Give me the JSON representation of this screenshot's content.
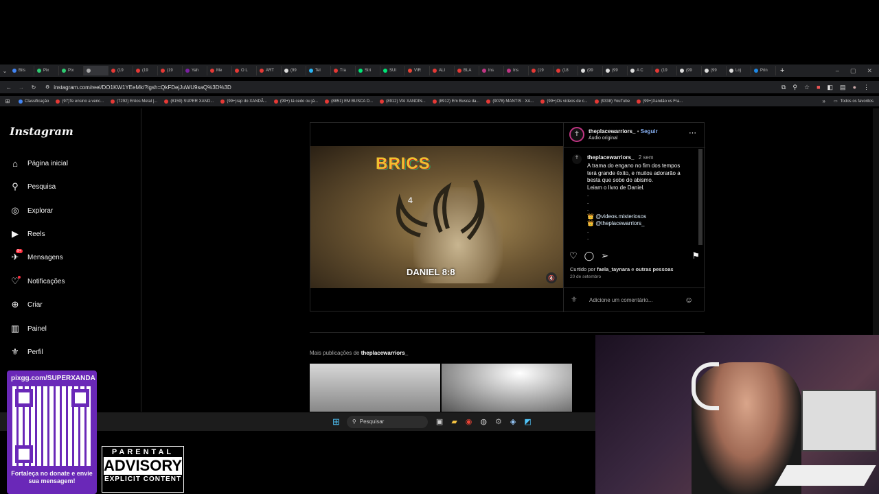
{
  "tabs": [
    "Bits",
    "Pix",
    "Pix",
    "",
    "(19",
    "(19",
    "(19",
    "Yah",
    "Me",
    "O L",
    "ART",
    "(99",
    "Tel",
    "Tra",
    "Stri",
    "SUI",
    "VIR",
    "ALI",
    "BLA",
    "Ins",
    "Ins",
    "(19",
    "(18",
    "(99",
    "(99",
    "A C",
    "(19",
    "(99",
    "(99",
    "Loj",
    "Prin"
  ],
  "address": {
    "url": "instagram.com/reel/DO1KW1YEeMk/?igsh=QkFDejJuWU9saQ%3D%3D"
  },
  "bookmarks": [
    "Classificação",
    "(97)Te ensino a venc...",
    "(7292) Erêos Metal |...",
    "(8159) SUPER XAND...",
    "(99+)rap do XANDÃ...",
    "(99+) tá cedo ou já...",
    "(8851) EM BUSCA D...",
    "(8912) VAI XANDIN...",
    "(8912) Em Busca da...",
    "(9078) MANTIS · XA...",
    "(99+)Os vídeos de c...",
    "(9338) YouTube",
    "(99+)Xandão vs Fra..."
  ],
  "bookmarks_folder": "Todos os favoritos",
  "sidebar": {
    "logo": "Instagram",
    "items": [
      "Página inicial",
      "Pesquisa",
      "Explorar",
      "Reels",
      "Mensagens",
      "Notificações",
      "Criar",
      "Painel",
      "Perfil"
    ],
    "messages_badge": "9+"
  },
  "post": {
    "username": "theplacewarriors_",
    "follow": "Seguir",
    "separator": "•",
    "audio": "Áudio original",
    "video_caption": "DANIEL 8:8",
    "video_number": "4",
    "video_title_art": "BRICS",
    "comment_user": "theplacewarriors_",
    "comment_time": "2 sem",
    "caption_lines": [
      "A trama do engano no fim dos tempos",
      "terá grande êxito, e muitos adorarão a",
      "besta que sobe do abismo.",
      "Leiam o livro de Daniel.",
      ".",
      ".",
      "."
    ],
    "mentions": [
      "@videos.misteriosos",
      "@theplacewarriors_"
    ],
    "tail_dots": [
      ".",
      "."
    ],
    "liked_prefix": "Curtido por",
    "liked_user": "faela_taynara",
    "liked_and": "e",
    "liked_suffix": "outras pessoas",
    "date": "20 de setembro",
    "comment_placeholder": "Adicione um comentário..."
  },
  "more": {
    "prefix": "Mais publicações de",
    "user": "theplacewarriors_"
  },
  "taskbar": {
    "search": "Pesquisar"
  },
  "overlay": {
    "pix_url": "pixgg.com/SUPERXANDA",
    "pix_cta": "Fortaleça no donate e envie sua mensagem!",
    "pa_line1": "PARENTAL",
    "pa_line2": "ADVISORY",
    "pa_line3": "EXPLICIT CONTENT"
  },
  "colors": {
    "accent": "#0095f6",
    "notify": "#ff3040",
    "bg": "#000000"
  }
}
